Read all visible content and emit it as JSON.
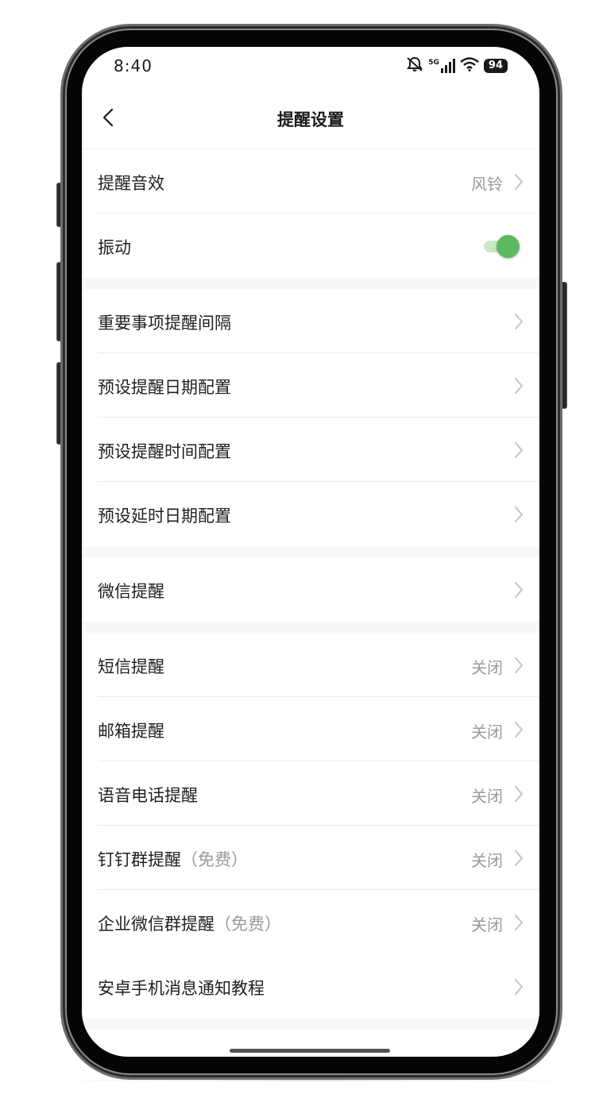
{
  "status_bar": {
    "time": "8:40",
    "network": "5G",
    "battery": "94"
  },
  "navbar": {
    "title": "提醒设置"
  },
  "toggle_on_color": "#5cb95f",
  "sections": [
    {
      "rows": [
        {
          "label": "提醒音效",
          "value": "风铃",
          "type": "link"
        },
        {
          "label": "振动",
          "type": "toggle",
          "checked": true
        }
      ]
    },
    {
      "rows": [
        {
          "label": "重要事项提醒间隔",
          "type": "link"
        },
        {
          "label": "预设提醒日期配置",
          "type": "link"
        },
        {
          "label": "预设提醒时间配置",
          "type": "link"
        },
        {
          "label": "预设延时日期配置",
          "type": "link"
        }
      ]
    },
    {
      "rows": [
        {
          "label": "微信提醒",
          "type": "link"
        }
      ]
    },
    {
      "rows": [
        {
          "label": "短信提醒",
          "value": "关闭",
          "type": "link"
        },
        {
          "label": "邮箱提醒",
          "value": "关闭",
          "type": "link"
        },
        {
          "label": "语音电话提醒",
          "value": "关闭",
          "type": "link"
        },
        {
          "label": "钉钉群提醒",
          "label_note": "（免费）",
          "value": "关闭",
          "type": "link"
        },
        {
          "label": "企业微信群提醒",
          "label_note": "（免费）",
          "value": "关闭",
          "type": "link"
        },
        {
          "label": "安卓手机消息通知教程",
          "type": "link"
        }
      ]
    }
  ]
}
